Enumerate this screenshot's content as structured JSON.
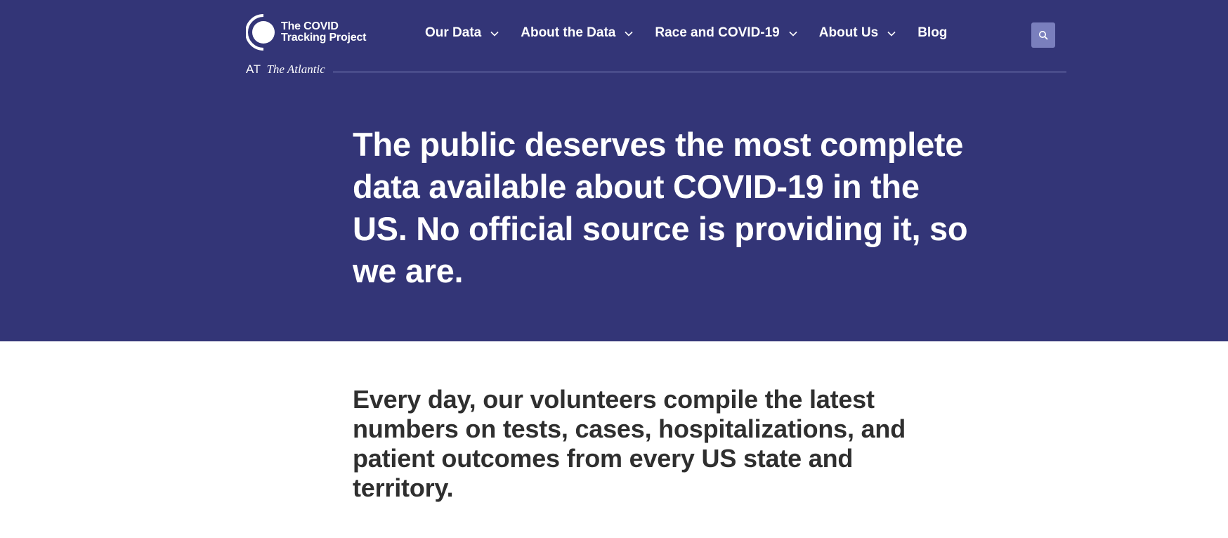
{
  "brand": {
    "name_line1": "The COVID",
    "name_line2": "Tracking Project",
    "at_label": "AT",
    "partner": "The Atlantic"
  },
  "nav": {
    "items": [
      {
        "label": "Our Data",
        "has_dropdown": true
      },
      {
        "label": "About the Data",
        "has_dropdown": true
      },
      {
        "label": "Race and COVID-19",
        "has_dropdown": true
      },
      {
        "label": "About Us",
        "has_dropdown": true
      },
      {
        "label": "Blog",
        "has_dropdown": false
      }
    ],
    "search_icon": "search-icon"
  },
  "hero": {
    "headline": "The public deserves the most complete data available about COVID-19 in the US. No official source is providing it, so we are."
  },
  "main": {
    "lead": "Every day, our volunteers compile the latest numbers on tests, cases, hospitalizations, and patient outcomes from every US state and territory."
  },
  "colors": {
    "hero_background": "#333577",
    "search_button": "#7a7fbd",
    "text_light": "#ffffff",
    "text_dark": "#2f2f2f"
  }
}
